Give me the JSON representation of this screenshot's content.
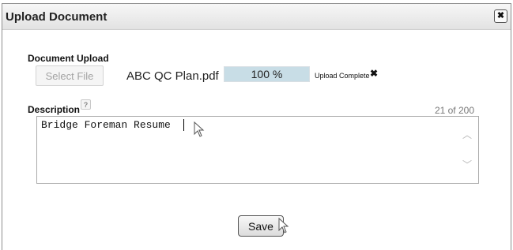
{
  "dialog": {
    "title": "Upload Document",
    "close_icon": "close-icon"
  },
  "upload": {
    "label": "Document Upload",
    "select_file_label": "Select File",
    "filename": "ABC QC Plan.pdf",
    "progress_text": "100 %",
    "progress_fraction": 1.0,
    "status_text": "Upload Complete",
    "remove_glyph": "✖"
  },
  "description": {
    "label": "Description",
    "help_glyph": "?",
    "char_count": "21 of 200",
    "value": "Bridge Foreman Resume",
    "scroll_up_glyph": "︿",
    "scroll_down_glyph": "﹀"
  },
  "actions": {
    "save_label": "Save"
  },
  "colors": {
    "progress_fill": "#c8dde6",
    "titlebar": "#e9e9e9"
  }
}
